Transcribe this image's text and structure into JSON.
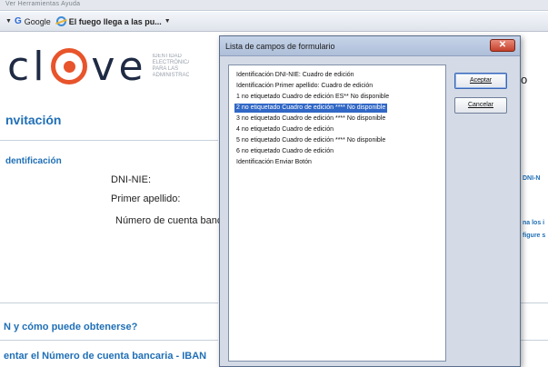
{
  "browser": {
    "menu_strip_text": "Ver   Herramientas   Ayuda",
    "favorites": [
      {
        "label": "Google",
        "icon": "google-icon"
      },
      {
        "label": "El fuego llega a las pu...",
        "icon": "ie-page-icon"
      }
    ]
  },
  "page": {
    "logo_text_left": "cl",
    "logo_text_right": "ve",
    "logo_subtitle": "IDENTIDAD ELECTRÓNICA PARA LAS ADMINISTRACIONES",
    "invitation_title": "nvitación",
    "identification_title": "dentificación",
    "fields": {
      "dni": "DNI-NIE:",
      "surname": "Primer apellido:",
      "account": "Número de cuenta bancaria"
    },
    "faq_1": "N y cómo puede obtenerse?",
    "faq_2": "entar el Número de cuenta bancaria - IBAN",
    "right_o": "o",
    "right_snippets": [
      "DNI-N",
      "na los i",
      "figure s"
    ]
  },
  "dialog": {
    "title": "Lista de campos de formulario",
    "close_label": "✕",
    "items": [
      "Identificación  DNI-NIE: Cuadro de edición",
      "Identificación  Primer apellido: Cuadro de edición",
      "1 no etiquetado Cuadro de edición ES**  No disponible",
      "2 no etiquetado Cuadro de edición ****  No disponible",
      "3 no etiquetado Cuadro de edición ****  No disponible",
      "4 no etiquetado Cuadro de edición",
      "5 no etiquetado Cuadro de edición ****  No disponible",
      "6 no etiquetado Cuadro de edición",
      "Identificación Enviar Botón"
    ],
    "selected_index": 3,
    "accept_label": "Aceptar",
    "cancel_label": "Cancelar"
  },
  "colors": {
    "accent_blue": "#1f6fb6",
    "logo_orange": "#e8542b",
    "selection": "#3168c6",
    "close_red": "#c5412b"
  }
}
